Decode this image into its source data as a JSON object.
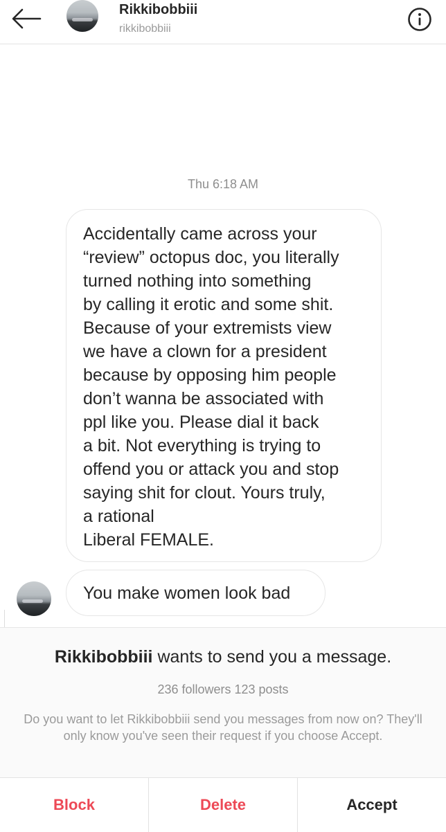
{
  "header": {
    "title": "Rikkibobbiii",
    "handle": "rikkibobbiii",
    "back_icon": "arrow-left-icon",
    "info_icon": "info-circle-icon"
  },
  "thread": {
    "timestamp": "Thu 6:18 AM",
    "messages": [
      {
        "lines": [
          "Accidentally came across your",
          "“review” octopus doc, you literally",
          "turned nothing into something",
          "by calling it erotic and some shit.",
          "Because of your extremists view",
          "we have a clown for a president",
          "because by opposing him people",
          "don’t wanna be associated with",
          "ppl like you. Please dial it back",
          "a bit. Not everything is trying to",
          "offend you or attack you and stop",
          "saying shit for clout. Yours truly,",
          "a rational",
          "Liberal FEMALE."
        ]
      },
      {
        "text": "You make women look bad"
      }
    ]
  },
  "request": {
    "sender_name": "Rikkibobbiii",
    "title_suffix": " wants to send you a message.",
    "stats": "236 followers 123 posts",
    "description": "Do you want to let Rikkibobbiii send you messages from now on? They'll only know you've seen their request if you choose Accept.",
    "buttons": {
      "block": "Block",
      "delete": "Delete",
      "accept": "Accept"
    }
  },
  "colors": {
    "danger": "#ed4956",
    "text_primary": "#262626",
    "text_secondary": "#8e8e8e",
    "border": "#e6e6e6"
  }
}
